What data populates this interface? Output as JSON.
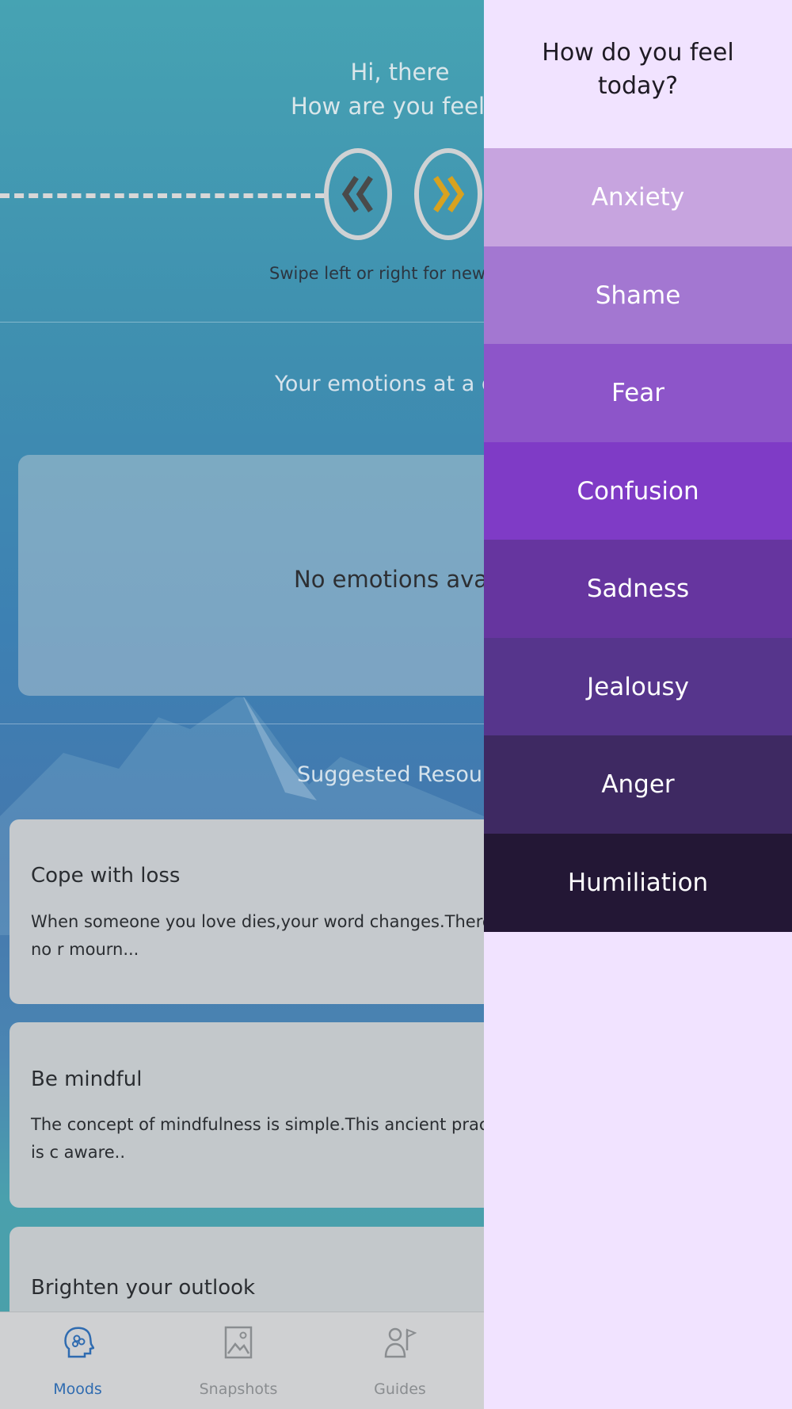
{
  "greeting": {
    "line1": "Hi, there",
    "line2": "How are you feelin"
  },
  "swipe_hint": "Swipe left or right for new sna",
  "emotions_section": {
    "title": "Your emotions at a gla",
    "empty_text": "No emotions availab"
  },
  "resources_section": {
    "title": "Suggested Resource"
  },
  "resources": [
    {
      "title": "Cope with loss",
      "body": "When someone you love dies,your word changes.There is no r mourn..."
    },
    {
      "title": "Be mindful",
      "body": "The concept of mindfulness is simple.This ancient practice is c aware.."
    },
    {
      "title": "Brighten your outlook",
      "body": ""
    }
  ],
  "nav": [
    {
      "label": "Moods",
      "icon": "head-brain-icon",
      "active": true
    },
    {
      "label": "Snapshots",
      "icon": "image-icon",
      "active": false
    },
    {
      "label": "Guides",
      "icon": "person-flag-icon",
      "active": false
    }
  ],
  "panel": {
    "title_line1": "How do you feel",
    "title_line2": "today?",
    "moods": [
      {
        "label": "Anxiety",
        "color": "#c7a4df"
      },
      {
        "label": "Shame",
        "color": "#a377d1"
      },
      {
        "label": "Fear",
        "color": "#8d55c9"
      },
      {
        "label": "Confusion",
        "color": "#7f3bc6"
      },
      {
        "label": "Sadness",
        "color": "#66359f"
      },
      {
        "label": "Jealousy",
        "color": "#56358c"
      },
      {
        "label": "Anger",
        "color": "#3e2962"
      },
      {
        "label": "Humiliation",
        "color": "#231735"
      }
    ]
  },
  "colors": {
    "accent_active": "#2f6bb0",
    "next_chevron": "#d8a21f",
    "prev_chevron": "#444444"
  }
}
